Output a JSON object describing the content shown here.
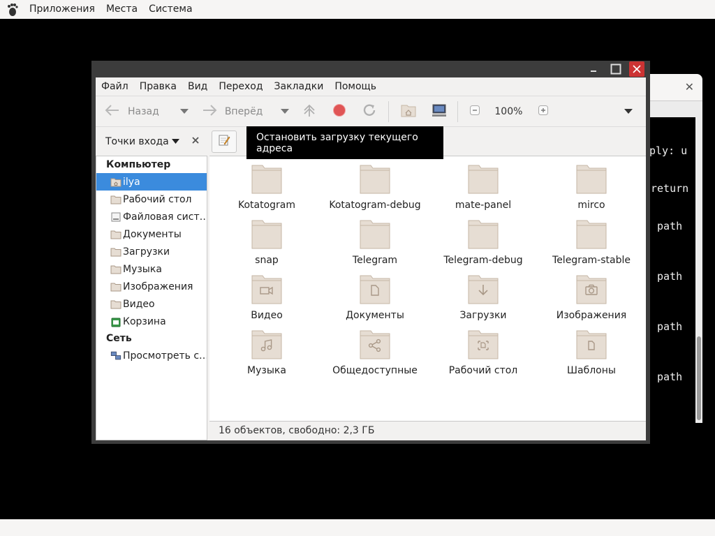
{
  "top_panel": {
    "menus": [
      "Приложения",
      "Места",
      "Система"
    ]
  },
  "background_terminal": {
    "lines": [
      "ply: u",
      "return",
      " path",
      " path",
      " path",
      " path"
    ]
  },
  "window": {
    "menubar": [
      "Файл",
      "Правка",
      "Вид",
      "Переход",
      "Закладки",
      "Помощь"
    ],
    "toolbar": {
      "back_label": "Назад",
      "forward_label": "Вперёд",
      "zoom_level": "100%"
    },
    "sidebar_header": "Точки входа",
    "tooltip": "Остановить загрузку текущего адреса",
    "sidebar": {
      "computer_heading": "Компьютер",
      "computer_items": [
        {
          "label": "ilya",
          "icon": "home-folder-icon"
        },
        {
          "label": "Рабочий стол",
          "icon": "desktop-folder-icon"
        },
        {
          "label": "Файловая сист…",
          "icon": "filesystem-icon"
        },
        {
          "label": "Документы",
          "icon": "folder-icon"
        },
        {
          "label": "Загрузки",
          "icon": "folder-icon"
        },
        {
          "label": "Музыка",
          "icon": "folder-icon"
        },
        {
          "label": "Изображения",
          "icon": "folder-icon"
        },
        {
          "label": "Видео",
          "icon": "folder-icon"
        },
        {
          "label": "Корзина",
          "icon": "trash-icon"
        }
      ],
      "network_heading": "Сеть",
      "network_items": [
        {
          "label": "Просмотреть с…",
          "icon": "network-icon"
        }
      ]
    },
    "files": [
      {
        "name": "Kotatogram",
        "emblem": "none"
      },
      {
        "name": "Kotatogram-debug",
        "emblem": "none"
      },
      {
        "name": "mate-panel",
        "emblem": "none"
      },
      {
        "name": "mirco",
        "emblem": "none"
      },
      {
        "name": "snap",
        "emblem": "none"
      },
      {
        "name": "Telegram",
        "emblem": "none"
      },
      {
        "name": "Telegram-debug",
        "emblem": "none"
      },
      {
        "name": "Telegram-stable",
        "emblem": "none"
      },
      {
        "name": "Видео",
        "emblem": "video"
      },
      {
        "name": "Документы",
        "emblem": "document"
      },
      {
        "name": "Загрузки",
        "emblem": "download"
      },
      {
        "name": "Изображения",
        "emblem": "camera"
      },
      {
        "name": "Музыка",
        "emblem": "music"
      },
      {
        "name": "Общедоступные",
        "emblem": "share"
      },
      {
        "name": "Рабочий стол",
        "emblem": "desktop"
      },
      {
        "name": "Шаблоны",
        "emblem": "template"
      }
    ],
    "status": "16 объектов, свободно: 2,3 ГБ"
  },
  "colors": {
    "selection": "#3b8bdd",
    "folder_fill": "#e6ddd3",
    "folder_stroke": "#c5b6a6",
    "close_button": "#cc3333",
    "stop_icon": "#e05555"
  }
}
